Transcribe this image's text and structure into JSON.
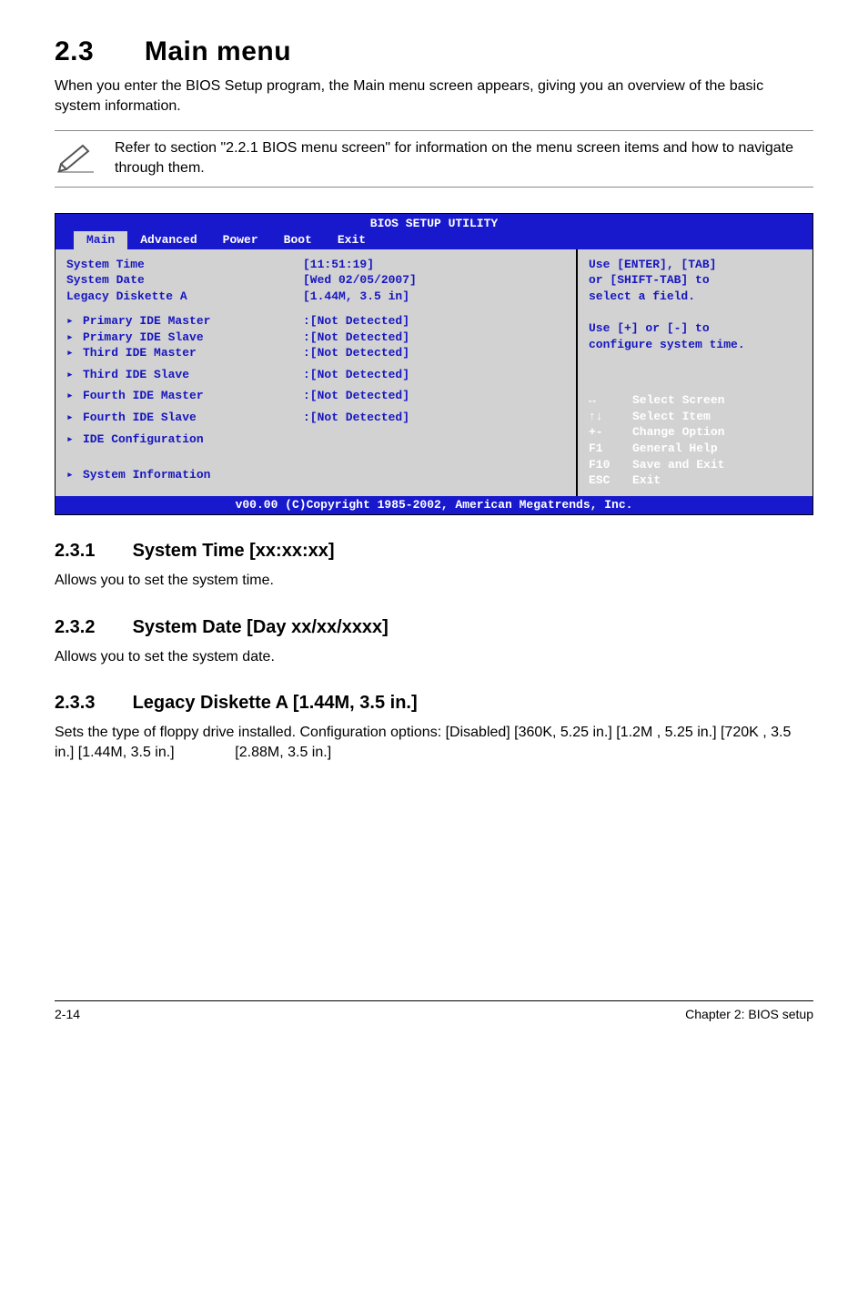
{
  "section": {
    "number": "2.3",
    "title": "Main menu",
    "intro": "When you enter the BIOS Setup program, the Main menu screen appears, giving you an overview of the basic system information.",
    "note": "Refer to section \"2.2.1  BIOS menu screen\" for information on the menu screen items and how to navigate through them."
  },
  "bios": {
    "title": "BIOS SETUP UTILITY",
    "tabs": [
      "Main",
      "Advanced",
      "Power",
      "Boot",
      "Exit"
    ],
    "selected_tab": "Main",
    "top_rows": [
      {
        "label": "System Time",
        "value": "[11:51:19]"
      },
      {
        "label": "System Date",
        "value": "[Wed 02/05/2007]"
      },
      {
        "label": "Legacy Diskette A",
        "value": "[1.44M, 3.5 in]"
      }
    ],
    "mid_rows": [
      {
        "label": "Primary IDE Master",
        "value": ":[Not Detected]"
      },
      {
        "label": "Primary IDE Slave",
        "value": ":[Not Detected]"
      },
      {
        "label": "Third IDE Master",
        "value": ":[Not Detected]"
      },
      {
        "label": "Third IDE Slave",
        "value": ":[Not Detected]"
      },
      {
        "label": "Fourth IDE Master",
        "value": ":[Not Detected]"
      },
      {
        "label": "Fourth IDE Slave",
        "value": ":[Not Detected]"
      },
      {
        "label": "IDE Configuration",
        "value": ""
      }
    ],
    "bottom_rows": [
      {
        "label": "System Information",
        "value": ""
      }
    ],
    "help1": [
      "Use [ENTER], [TAB]",
      "or [SHIFT-TAB] to",
      "select a field."
    ],
    "help2": [
      "Use [+] or [-] to",
      "configure system time."
    ],
    "keyhelp": [
      {
        "k": "↔",
        "t": "Select Screen"
      },
      {
        "k": "↑↓",
        "t": "Select Item"
      },
      {
        "k": "+-",
        "t": "Change Option"
      },
      {
        "k": "F1",
        "t": "General Help"
      },
      {
        "k": "F10",
        "t": "Save and Exit"
      },
      {
        "k": "ESC",
        "t": "Exit"
      }
    ],
    "footer": "v00.00 (C)Copyright 1985-2002, American Megatrends, Inc."
  },
  "subs": {
    "s1": {
      "num": "2.3.1",
      "title": "System Time [xx:xx:xx]",
      "body": "Allows you to set the system time."
    },
    "s2": {
      "num": "2.3.2",
      "title": "System Date [Day xx/xx/xxxx]",
      "body": "Allows you to set the system date."
    },
    "s3": {
      "num": "2.3.3",
      "title": "Legacy Diskette A [1.44M, 3.5 in.]",
      "body": "Sets the type of floppy drive installed. Configuration options: [Disabled] [360K, 5.25 in.] [1.2M , 5.25 in.] [720K , 3.5 in.] [1.44M, 3.5 in.]               [2.88M, 3.5 in.]"
    }
  },
  "footer": {
    "left": "2-14",
    "right": "Chapter 2: BIOS setup"
  }
}
